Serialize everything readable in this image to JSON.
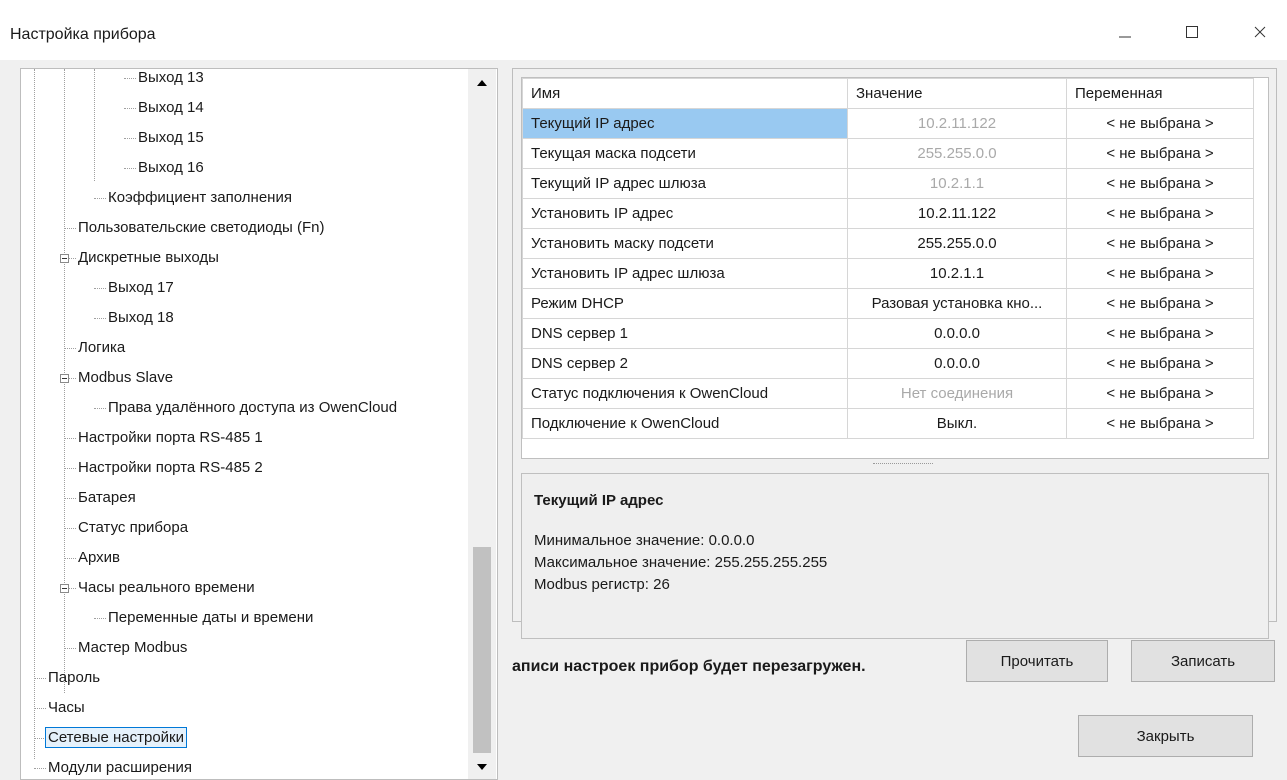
{
  "window": {
    "title": "Настройка прибора",
    "controls": {
      "minimize": "minimize-icon",
      "maximize": "maximize-icon",
      "close": "close-icon"
    }
  },
  "tree": {
    "items": [
      {
        "label": "Выход 13",
        "level": 3,
        "expander": false
      },
      {
        "label": "Выход 14",
        "level": 3,
        "expander": false
      },
      {
        "label": "Выход 15",
        "level": 3,
        "expander": false
      },
      {
        "label": "Выход 16",
        "level": 3,
        "expander": false
      },
      {
        "label": "Коэффициент заполнения",
        "level": 2,
        "expander": false
      },
      {
        "label": "Пользовательские светодиоды (Fn)",
        "level": 1,
        "expander": false
      },
      {
        "label": "Дискретные выходы",
        "level": 1,
        "expander": true
      },
      {
        "label": "Выход 17",
        "level": 2,
        "expander": false
      },
      {
        "label": "Выход 18",
        "level": 2,
        "expander": false
      },
      {
        "label": "Логика",
        "level": 1,
        "expander": false
      },
      {
        "label": "Modbus Slave",
        "level": 1,
        "expander": true
      },
      {
        "label": "Права удалённого доступа из OwenCloud",
        "level": 2,
        "expander": false
      },
      {
        "label": "Настройки порта RS-485 1",
        "level": 1,
        "expander": false
      },
      {
        "label": "Настройки порта RS-485 2",
        "level": 1,
        "expander": false
      },
      {
        "label": "Батарея",
        "level": 1,
        "expander": false
      },
      {
        "label": "Статус прибора",
        "level": 1,
        "expander": false
      },
      {
        "label": "Архив",
        "level": 1,
        "expander": false
      },
      {
        "label": "Часы реального времени",
        "level": 1,
        "expander": true
      },
      {
        "label": "Переменные даты и времени",
        "level": 2,
        "expander": false
      },
      {
        "label": "Мастер Modbus",
        "level": 1,
        "expander": false
      },
      {
        "label": "Пароль",
        "level": 0,
        "expander": false
      },
      {
        "label": "Часы",
        "level": 0,
        "expander": false
      },
      {
        "label": "Сетевые настройки",
        "level": 0,
        "expander": false,
        "selected": true
      },
      {
        "label": "Модули расширения",
        "level": 0,
        "expander": false
      }
    ]
  },
  "table": {
    "columns": [
      "Имя",
      "Значение",
      "Переменная"
    ],
    "rows": [
      {
        "name": "Текущий IP адрес",
        "value": "10.2.11.122",
        "variable": "< не выбрана >",
        "dim": true,
        "selected": true
      },
      {
        "name": "Текущая маска подсети",
        "value": "255.255.0.0",
        "variable": "< не выбрана >",
        "dim": true
      },
      {
        "name": "Текущий IP адрес шлюза",
        "value": "10.2.1.1",
        "variable": "< не выбрана >",
        "dim": true
      },
      {
        "name": "Установить IP адрес",
        "value": "10.2.11.122",
        "variable": "< не выбрана >",
        "dim": false
      },
      {
        "name": "Установить маску подсети",
        "value": "255.255.0.0",
        "variable": "< не выбрана >",
        "dim": false
      },
      {
        "name": "Установить IP адрес шлюза",
        "value": "10.2.1.1",
        "variable": "< не выбрана >",
        "dim": false
      },
      {
        "name": "Режим DHCP",
        "value": "Разовая установка кно...",
        "variable": "< не выбрана >",
        "dim": false
      },
      {
        "name": "DNS сервер 1",
        "value": "0.0.0.0",
        "variable": "< не выбрана >",
        "dim": false
      },
      {
        "name": "DNS сервер 2",
        "value": "0.0.0.0",
        "variable": "< не выбрана >",
        "dim": false
      },
      {
        "name": "Статус подключения к OwenCloud",
        "value": "Нет соединения",
        "variable": "< не выбрана >",
        "dim": true
      },
      {
        "name": "Подключение к OwenCloud",
        "value": "Выкл.",
        "variable": "< не выбрана >",
        "dim": false
      }
    ]
  },
  "info": {
    "title": "Текущий IP адрес",
    "min": "Минимальное значение: 0.0.0.0",
    "max": "Максимальное значение: 255.255.255.255",
    "register": "Modbus регистр: 26"
  },
  "footer": {
    "note": "аписи настроек прибор будет перезагружен.",
    "read_label": "Прочитать",
    "write_label": "Записать",
    "close_label": "Закрыть"
  },
  "colors": {
    "selection": "#99c9f1",
    "tree_selection_border": "#0078d7",
    "dim_text": "#a9a9a9"
  }
}
